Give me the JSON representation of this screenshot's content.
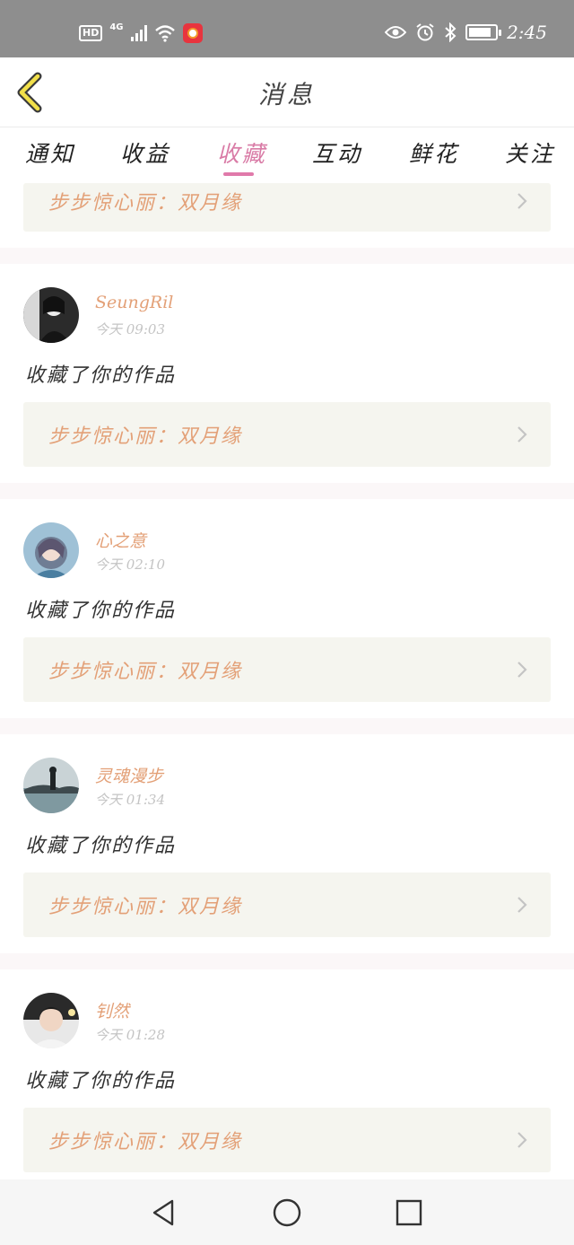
{
  "status_bar": {
    "hd_label": "HD",
    "network_label": "4G",
    "signal_level": 1.0,
    "battery_level": 0.85,
    "time": "2:45",
    "icons": [
      "signal-icon",
      "wifi-icon",
      "app-notification-icon",
      "eye-icon",
      "alarm-icon",
      "bluetooth-icon",
      "battery-icon"
    ]
  },
  "header": {
    "title": "消息",
    "back_icon": "chevron-left-icon"
  },
  "tabs": [
    {
      "label": "通知",
      "active": false
    },
    {
      "label": "收益",
      "active": false
    },
    {
      "label": "收藏",
      "active": true
    },
    {
      "label": "互动",
      "active": false
    },
    {
      "label": "鲜花",
      "active": false
    },
    {
      "label": "关注",
      "active": false
    }
  ],
  "colors": {
    "accent_pink": "#d97ba6",
    "name_orange": "#e3a077",
    "work_box_bg": "#f5f5ef",
    "status_bar_bg": "#8e8e8e"
  },
  "partial_top_item": {
    "work_title": "步步惊心丽：双月缘"
  },
  "feed": [
    {
      "user": "SeungRil",
      "time": "今天 09:03",
      "action": "收藏了你的作品",
      "work_title": "步步惊心丽：双月缘",
      "avatar": "avatar-monochrome"
    },
    {
      "user": "心之意",
      "time": "今天 02:10",
      "action": "收藏了你的作品",
      "work_title": "步步惊心丽：双月缘",
      "avatar": "avatar-anime-girl"
    },
    {
      "user": "灵魂漫步",
      "time": "今天 01:34",
      "action": "收藏了你的作品",
      "work_title": "步步惊心丽：双月缘",
      "avatar": "avatar-landscape"
    },
    {
      "user": "钊然",
      "time": "今天 01:28",
      "action": "收藏了你的作品",
      "work_title": "步步惊心丽：双月缘",
      "avatar": "avatar-portrait"
    }
  ],
  "nav_bar": {
    "buttons": [
      "back-triangle-icon",
      "home-circle-icon",
      "recents-square-icon"
    ]
  }
}
